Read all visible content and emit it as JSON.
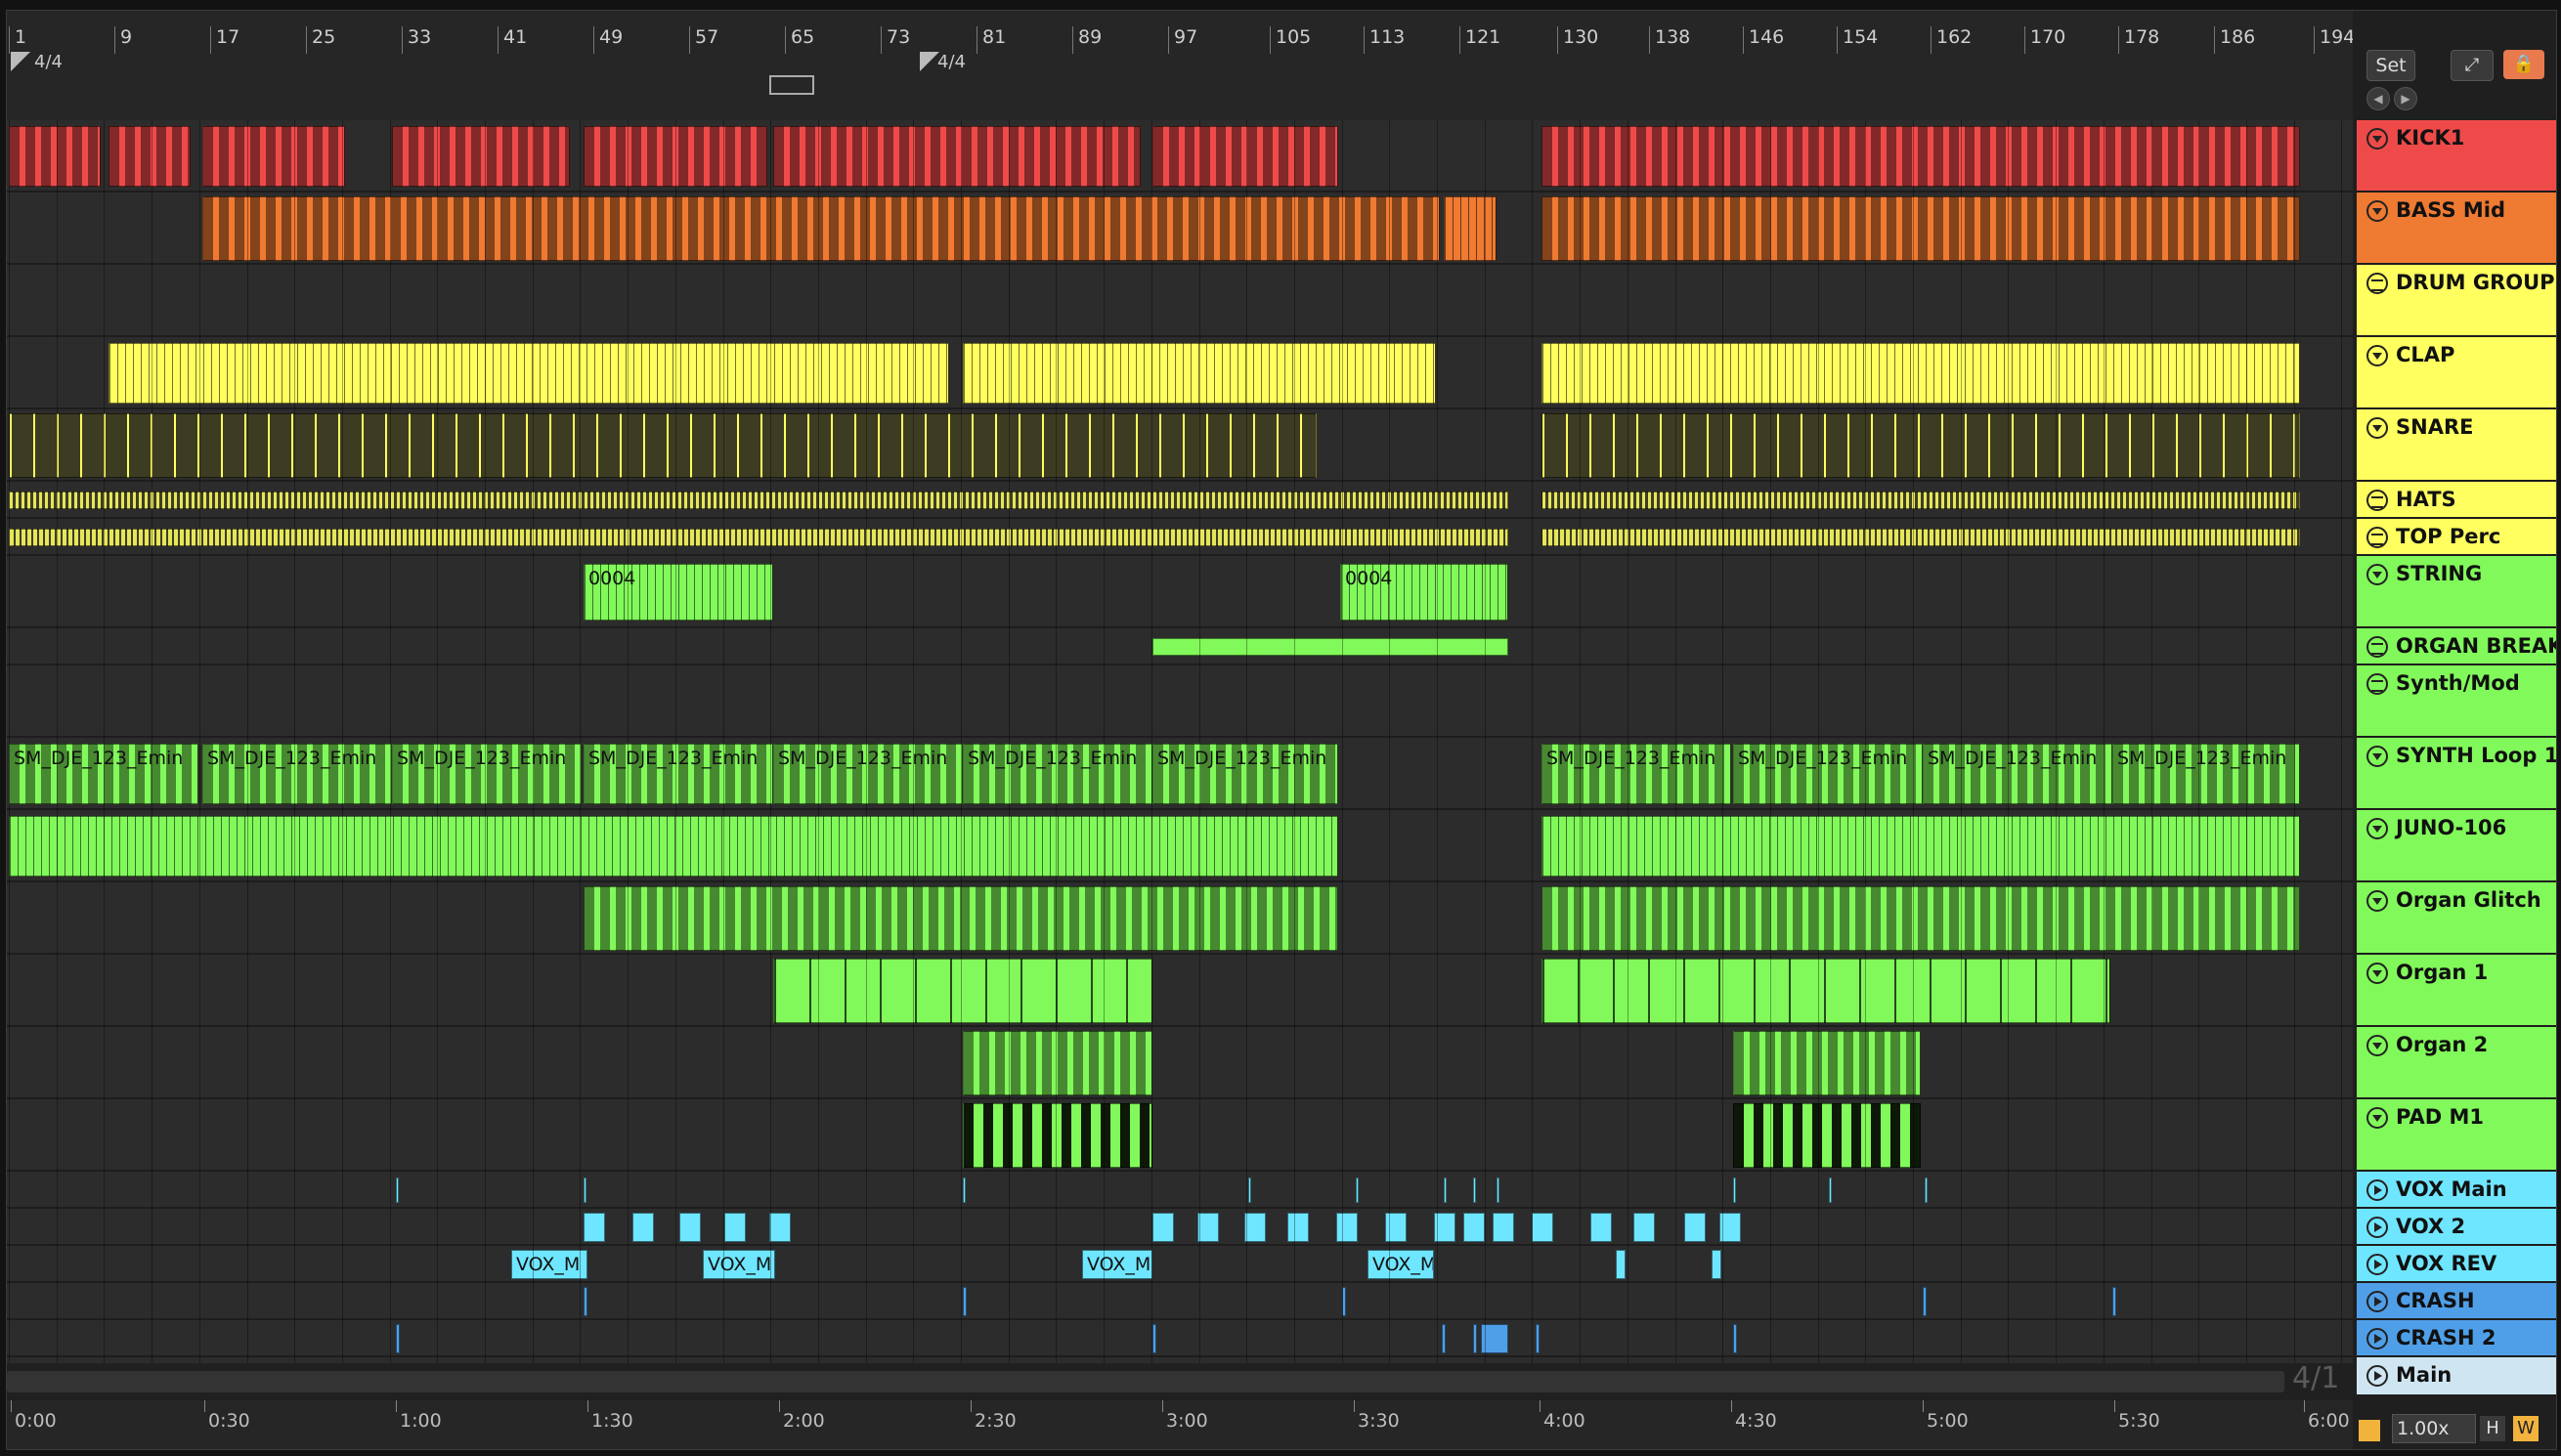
{
  "set_label": "Set",
  "time_signature_1": "4/4",
  "time_signature_2": "4/4",
  "position_readout": "4/1",
  "zoom_level": "1.00x",
  "h_label": "H",
  "w_label": "W",
  "bar_numbers": [
    "1",
    "9",
    "17",
    "25",
    "33",
    "41",
    "49",
    "57",
    "65",
    "73",
    "81",
    "89",
    "97",
    "105",
    "113",
    "121",
    "130",
    "138",
    "146",
    "154",
    "162",
    "170",
    "178",
    "186",
    "194"
  ],
  "time_labels": [
    "0:00",
    "0:30",
    "1:00",
    "1:30",
    "2:00",
    "2:30",
    "3:00",
    "3:30",
    "4:00",
    "4:30",
    "5:00",
    "5:30",
    "6:00"
  ],
  "colors": {
    "red": "#ef4a4a",
    "orange": "#ef7a32",
    "yellow": "#ffff5f",
    "green": "#81f95a",
    "cyan": "#6fe6ff",
    "blue": "#4f9fe8",
    "main": "#cfe6f2"
  },
  "tracks": [
    {
      "name": "KICK1",
      "color": "#ef4a4a",
      "icon": "fold-icon"
    },
    {
      "name": "BASS Mid",
      "color": "#ef7a32",
      "icon": "fold-icon"
    },
    {
      "name": "DRUM GROUP",
      "color": "#ffff5f",
      "icon": "group-icon"
    },
    {
      "name": "CLAP",
      "color": "#ffff5f",
      "icon": "fold-icon"
    },
    {
      "name": "SNARE",
      "color": "#ffff5f",
      "icon": "fold-icon"
    },
    {
      "name": "HATS",
      "color": "#ffff5f",
      "icon": "group-icon"
    },
    {
      "name": "TOP Perc",
      "color": "#ffff5f",
      "icon": "group-icon"
    },
    {
      "name": "STRING",
      "color": "#81f95a",
      "icon": "fold-icon"
    },
    {
      "name": "ORGAN BREAK",
      "color": "#81f95a",
      "icon": "group-icon"
    },
    {
      "name": "Synth/Mod",
      "color": "#81f95a",
      "icon": "group-icon"
    },
    {
      "name": "SYNTH Loop 1",
      "color": "#81f95a",
      "icon": "fold-icon"
    },
    {
      "name": "JUNO-106",
      "color": "#81f95a",
      "icon": "fold-icon"
    },
    {
      "name": "Organ Glitch",
      "color": "#81f95a",
      "icon": "fold-icon"
    },
    {
      "name": "Organ 1",
      "color": "#81f95a",
      "icon": "fold-icon"
    },
    {
      "name": "Organ 2",
      "color": "#81f95a",
      "icon": "fold-icon"
    },
    {
      "name": "PAD M1",
      "color": "#81f95a",
      "icon": "fold-icon"
    },
    {
      "name": "VOX Main",
      "color": "#6fe6ff",
      "icon": "play-icon"
    },
    {
      "name": "VOX 2",
      "color": "#6fe6ff",
      "icon": "play-icon"
    },
    {
      "name": "VOX REV",
      "color": "#6fe6ff",
      "icon": "play-icon"
    },
    {
      "name": "CRASH",
      "color": "#4f9fe8",
      "icon": "play-icon"
    },
    {
      "name": "CRASH 2",
      "color": "#4f9fe8",
      "icon": "play-icon"
    },
    {
      "name": "Main",
      "color": "#cfe6f2",
      "icon": "play-icon"
    }
  ],
  "clip_labels": {
    "synth_loop": "SM_DJE_123_Emin",
    "vox_rev": "VOX_M",
    "string": "0004"
  }
}
